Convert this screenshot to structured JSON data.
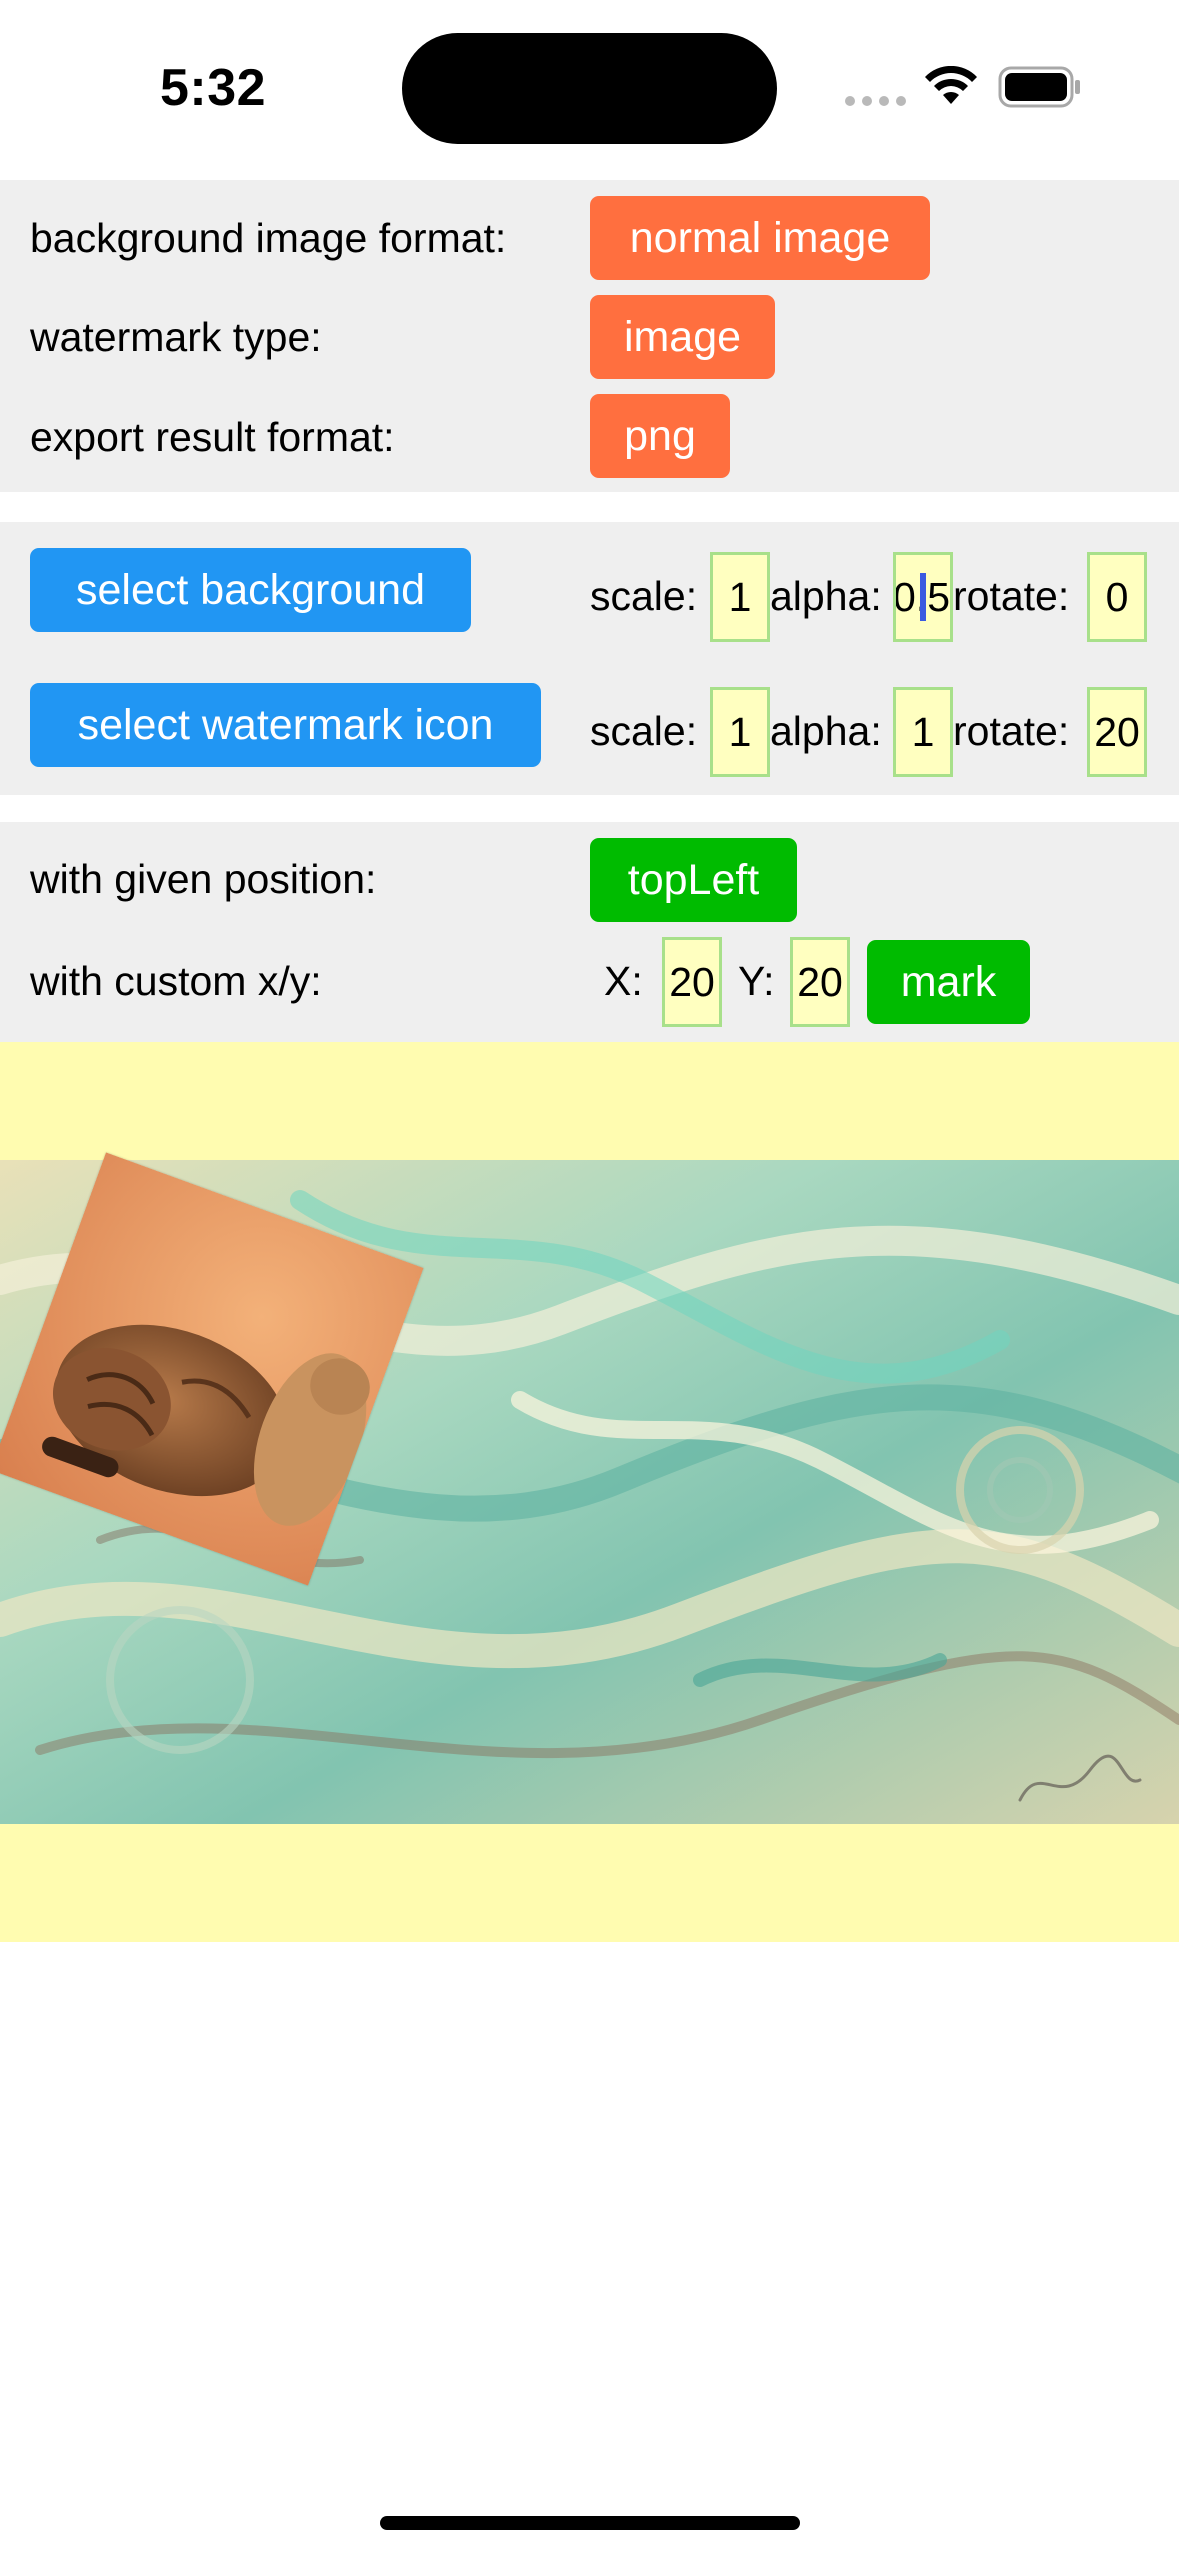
{
  "status_bar": {
    "time": "5:32",
    "icons": [
      "cellular-signal-icon",
      "wifi-icon",
      "battery-icon"
    ]
  },
  "format_panel": {
    "background_label": "background image format:",
    "background_value": "normal image",
    "watermark_label": "watermark type:",
    "watermark_value": "image",
    "export_label": "export result format:",
    "export_value": "png"
  },
  "image_panel": {
    "select_background": "select background",
    "select_watermark": "select watermark icon",
    "background_params": {
      "scale_label": "scale:",
      "scale": "1",
      "alpha_label": "alpha:",
      "alpha": "0.5",
      "rotate_label": "rotate:",
      "rotate": "0"
    },
    "watermark_params": {
      "scale_label": "scale:",
      "scale": "1",
      "alpha_label": "alpha:",
      "alpha": "1",
      "rotate_label": "rotate:",
      "rotate": "20"
    }
  },
  "position_panel": {
    "given_label": "with given position:",
    "given_value": "topLeft",
    "custom_label": "with custom x/y:",
    "x_label": "X:",
    "x": "20",
    "y_label": "Y:",
    "y": "20",
    "mark_button": "mark"
  },
  "colors": {
    "orange": "#ff6f3f",
    "blue": "#2196f3",
    "green": "#00bb00",
    "panel": "#efefef",
    "field": "#ffffc0",
    "preview": "#fffcb0"
  }
}
